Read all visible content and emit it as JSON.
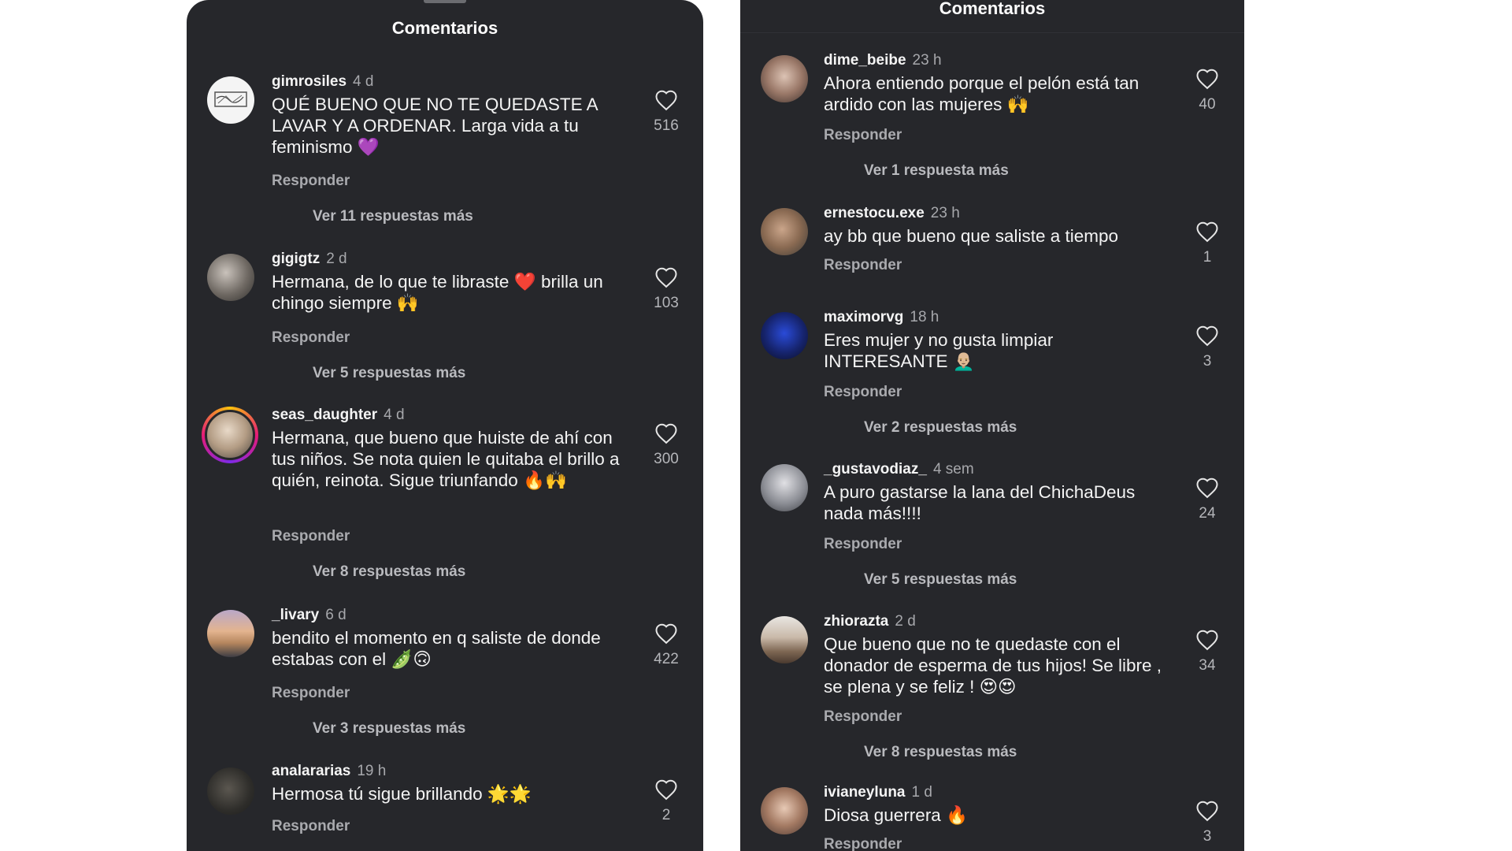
{
  "left": {
    "title": "Comentarios",
    "comments": [
      {
        "user": "gimrosiles",
        "time": "4 d",
        "text": "QUÉ BUENO QUE NO TE QUEDASTE A LAVAR Y A ORDENAR. Larga vida a tu feminismo 💜",
        "reply": "Responder",
        "likes": "516",
        "more": "Ver 11 respuestas más"
      },
      {
        "user": "gigigtz",
        "time": "2 d",
        "text": "Hermana, de lo que te libraste ❤️ brilla un chingo siempre 🙌",
        "reply": "Responder",
        "likes": "103",
        "more": "Ver 5 respuestas más"
      },
      {
        "user": "seas_daughter",
        "time": "4 d",
        "text": "Hermana, que bueno que huiste de ahí con tus niños. Se nota quien le quitaba el brillo a quién, reinota. Sigue triunfando 🔥🙌",
        "reply": "Responder",
        "likes": "300",
        "more": "Ver 8 respuestas más"
      },
      {
        "user": "_livary",
        "time": "6 d",
        "text": "bendito el momento en q saliste de donde estabas con el 🫛🙃",
        "reply": "Responder",
        "likes": "422",
        "more": "Ver 3 respuestas más"
      },
      {
        "user": "analararias",
        "time": "19 h",
        "text": "Hermosa tú sigue brillando 🌟🌟",
        "reply": "Responder",
        "likes": "2"
      }
    ]
  },
  "right": {
    "title": "Comentarios",
    "comments": [
      {
        "user": "dime_beibe",
        "time": "23 h",
        "text": "Ahora entiendo porque el pelón está tan ardido con las mujeres 🙌",
        "reply": "Responder",
        "likes": "40",
        "more": "Ver 1 respuesta más"
      },
      {
        "user": "ernestocu.exe",
        "time": "23 h",
        "text": "ay bb que bueno que saliste a tiempo",
        "reply": "Responder",
        "likes": "1"
      },
      {
        "user": "maximorvg",
        "time": "18 h",
        "text": "Eres mujer y no gusta limpiar INTERESANTE 👨🏼‍🦲",
        "reply": "Responder",
        "likes": "3",
        "more": "Ver 2 respuestas más"
      },
      {
        "user": "_gustavodiaz_",
        "time": "4 sem",
        "text": "A puro gastarse la lana del ChichaDeus nada más!!!!",
        "reply": "Responder",
        "likes": "24",
        "more": "Ver 5 respuestas más"
      },
      {
        "user": "zhiorazta",
        "time": "2 d",
        "text": "Que bueno que no te quedaste con el donador de esperma de tus hijos! Se libre , se plena y se feliz ! 😍😍",
        "reply": "Responder",
        "likes": "34",
        "more": "Ver 8 respuestas más"
      },
      {
        "user": "ivianeyluna",
        "time": "1 d",
        "text": "Diosa guerrera 🔥",
        "reply": "Responder",
        "likes": "3"
      }
    ]
  },
  "colors": {
    "panel_bg": "#26272b",
    "text_primary": "#f4f4f4",
    "text_secondary": "#a9aaae"
  },
  "icons": {
    "like": "heart-outline-icon"
  }
}
